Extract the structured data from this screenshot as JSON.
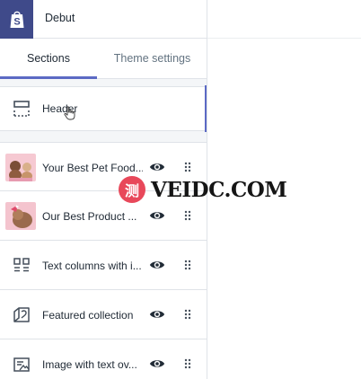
{
  "app": {
    "theme_name": "Debut"
  },
  "tabs": [
    {
      "label": "Sections",
      "active": true
    },
    {
      "label": "Theme settings",
      "active": false
    }
  ],
  "header_section": {
    "label": "Header",
    "icon": "header-layout-icon",
    "selected": true
  },
  "sections": [
    {
      "label": "Your Best Pet Food...",
      "icon": "image-thumbnail",
      "visible": true
    },
    {
      "label": "Our Best Product ...",
      "icon": "image-thumbnail",
      "visible": true
    },
    {
      "label": "Text columns with i...",
      "icon": "text-columns-icon",
      "visible": true
    },
    {
      "label": "Featured collection",
      "icon": "collection-icon",
      "visible": true
    },
    {
      "label": "Image with text ov...",
      "icon": "image-overlay-icon",
      "visible": true
    }
  ],
  "watermark": {
    "badge_text": "测",
    "text": "VEIDC.COM"
  },
  "colors": {
    "accent": "#5c6ac4",
    "logo_bg": "#3f4a8a",
    "panel_bg": "#f4f6f8",
    "border": "#dfe3e8"
  }
}
